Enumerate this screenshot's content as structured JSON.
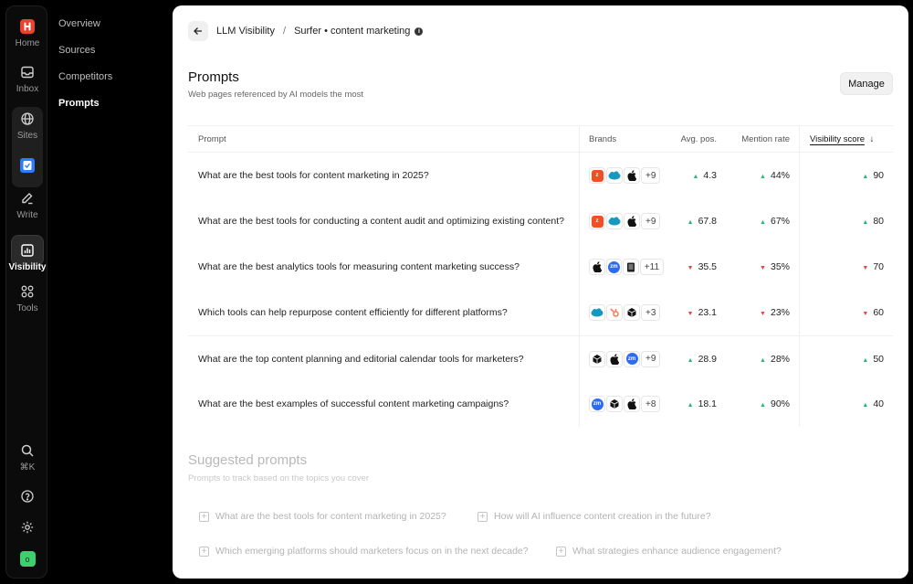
{
  "rail": {
    "home": "Home",
    "inbox": "Inbox",
    "sites": "Sites",
    "write": "Write",
    "visibility": "Visibility",
    "tools": "Tools",
    "search_shortcut": "⌘K",
    "avatar_initial": "o"
  },
  "subnav": {
    "items": [
      "Overview",
      "Sources",
      "Competitors",
      "Prompts"
    ]
  },
  "breadcrumb": {
    "root": "LLM Visibility",
    "separator": "/",
    "current": "Surfer • content marketing"
  },
  "header": {
    "title": "Prompts",
    "subtitle": "Web pages referenced by AI models the most",
    "manage_label": "Manage"
  },
  "table": {
    "columns": {
      "prompt": "Prompt",
      "brands": "Brands",
      "avg_pos": "Avg. pos.",
      "mention_rate": "Mention rate",
      "visibility_score": "Visibility score"
    },
    "rows": [
      {
        "prompt": "What are the best tools for content marketing in 2025?",
        "more": "+9",
        "avg": "4.3",
        "avg_dir": "up",
        "mention": "44%",
        "mention_dir": "up",
        "vis": "90",
        "vis_dir": "up"
      },
      {
        "prompt": "What are the best tools for conducting a content audit and optimizing existing content?",
        "more": "+9",
        "avg": "67.8",
        "avg_dir": "up",
        "mention": "67%",
        "mention_dir": "up",
        "vis": "80",
        "vis_dir": "up"
      },
      {
        "prompt": "What are the best analytics tools for measuring content marketing success?",
        "more": "+11",
        "avg": "35.5",
        "avg_dir": "down",
        "mention": "35%",
        "mention_dir": "down",
        "vis": "70",
        "vis_dir": "down"
      },
      {
        "prompt": "Which tools can help repurpose content efficiently for different platforms?",
        "more": "+3",
        "avg": "23.1",
        "avg_dir": "down",
        "mention": "23%",
        "mention_dir": "down",
        "vis": "60",
        "vis_dir": "down"
      },
      {
        "prompt": "What are the top content planning and editorial calendar tools for marketers?",
        "more": "+9",
        "avg": "28.9",
        "avg_dir": "up",
        "mention": "28%",
        "mention_dir": "up",
        "vis": "50",
        "vis_dir": "up"
      },
      {
        "prompt": "What are the best examples of successful content marketing campaigns?",
        "more": "+8",
        "avg": "18.1",
        "avg_dir": "up",
        "mention": "90%",
        "mention_dir": "up",
        "vis": "40",
        "vis_dir": "up"
      }
    ]
  },
  "suggested": {
    "title": "Suggested prompts",
    "subtitle": "Prompts to track based on the topics you cover",
    "items": [
      "What are the best tools for content marketing in 2025?",
      "How will AI influence content creation in the future?",
      "Which emerging platforms should marketers focus on in the next decade?",
      "What strategies enhance audience engagement?"
    ]
  },
  "colors": {
    "up": "#2bb673",
    "down": "#e5483f",
    "brand_red": "#f04e23",
    "brand_salesforce": "#1798c1",
    "brand_zoom": "#2d6cf0",
    "brand_hubspot": "#ff7a59"
  }
}
